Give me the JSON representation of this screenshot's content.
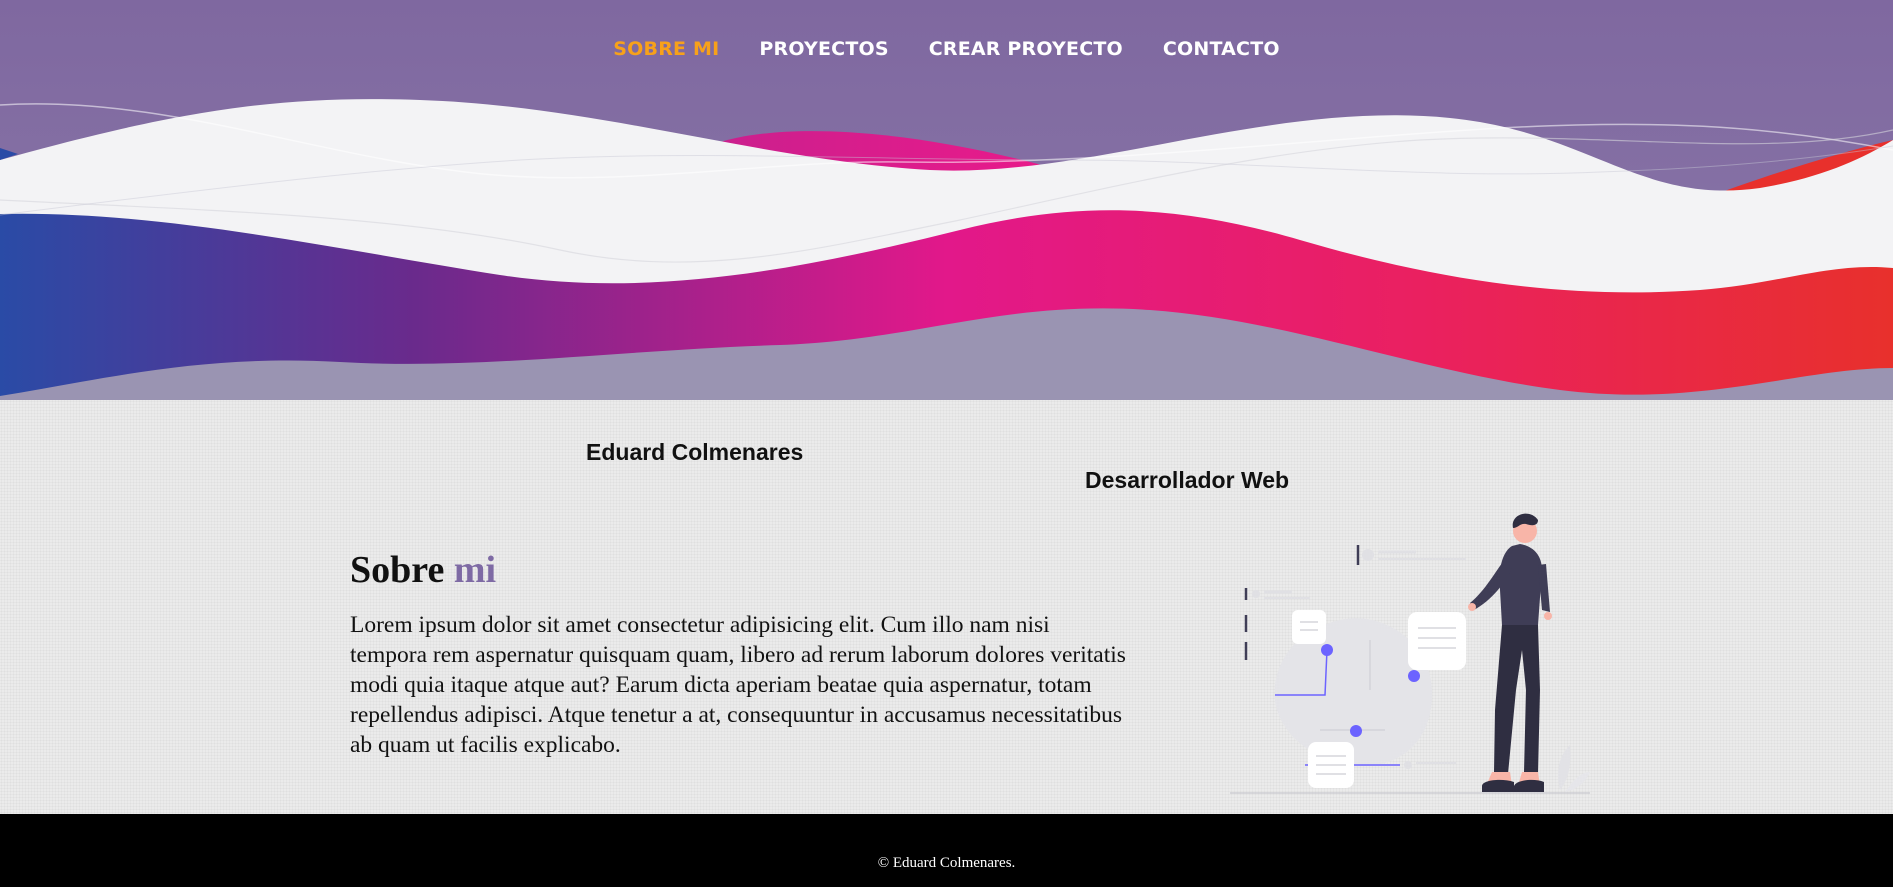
{
  "nav": {
    "items": [
      {
        "label": "SOBRE MI",
        "active": true
      },
      {
        "label": "PROYECTOS",
        "active": false
      },
      {
        "label": "CREAR PROYECTO",
        "active": false
      },
      {
        "label": "CONTACTO",
        "active": false
      }
    ]
  },
  "profile": {
    "name": "Eduard Colmenares",
    "role": "Desarrollador Web"
  },
  "about": {
    "title_part1": "Sobre",
    "title_part2": "mi",
    "text": "Lorem ipsum dolor sit amet consectetur adipisicing elit. Cum illo nam nisi tempora rem aspernatur quisquam quam, libero ad rerum laborum dolores veritatis modi quia itaque atque aut? Earum dicta aperiam beatae quia aspernatur, totam repellendus adipisci. Atque tenetur a at, consequuntur in accusamus necessitatibus ab quam ut facilis explicabo."
  },
  "footer": {
    "text": "© Eduard Colmenares."
  },
  "colors": {
    "header_purple": "#7f68a0",
    "active_nav": "#f7a11a",
    "accent_purple": "#7e6aa4",
    "footer_bg": "#000000"
  }
}
